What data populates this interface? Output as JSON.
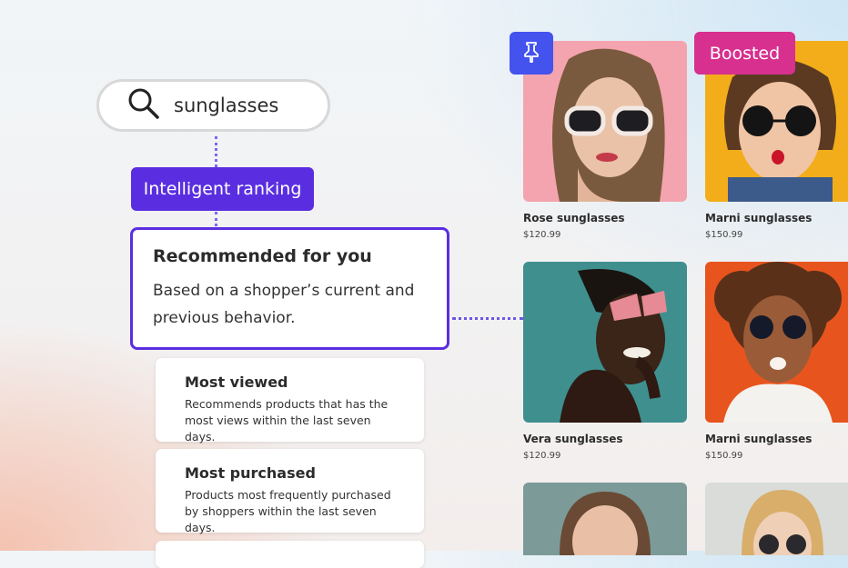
{
  "search": {
    "query": "sunglasses",
    "icon": "search-icon"
  },
  "ranking_label": "Intelligent ranking",
  "recommended": {
    "title": "Recommended for you",
    "description": "Based on a shopper’s current and previous  behavior."
  },
  "strategies": [
    {
      "title": "Most viewed",
      "description": "Recommends products that has the most views within the last seven days."
    },
    {
      "title": "Most purchased",
      "description": "Products most frequently purchased by shoppers within the last seven days."
    }
  ],
  "badges": {
    "pin_icon": "pin-icon",
    "boosted": "Boosted"
  },
  "products": [
    {
      "name": "Rose sunglasses",
      "price": "$120.99"
    },
    {
      "name": "Marni sunglasses",
      "price": "$150.99"
    },
    {
      "name": "Vera sunglasses",
      "price": "$120.99"
    },
    {
      "name": "Marni sunglasses",
      "price": "$150.99"
    },
    {
      "name": "",
      "price": ""
    },
    {
      "name": "",
      "price": ""
    }
  ],
  "colors": {
    "accent": "#5a2ee0",
    "pin": "#4452ee",
    "boosted": "#d7308f"
  }
}
